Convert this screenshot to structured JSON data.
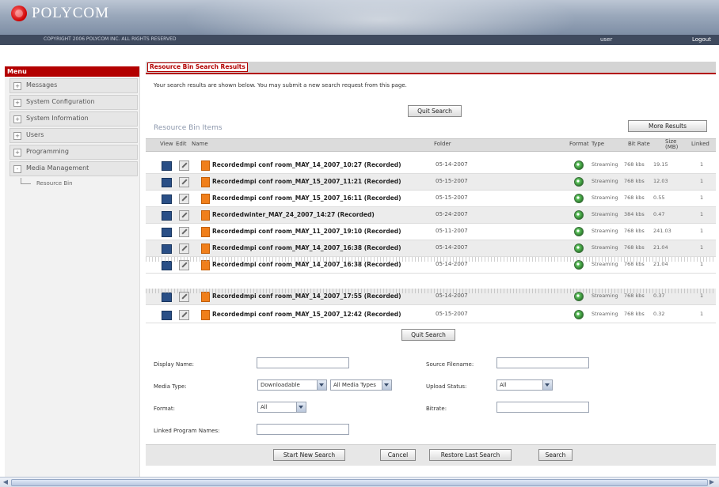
{
  "header": {
    "logo": "POLYCOM",
    "copyright": "COPYRIGHT 2006 POLYCOM INC. ALL RIGHTS RESERVED",
    "user": "user",
    "logout": "Logout"
  },
  "menu": {
    "title": "Menu",
    "items": [
      {
        "label": "Messages",
        "state": "+"
      },
      {
        "label": "System Configuration",
        "state": "+"
      },
      {
        "label": "System Information",
        "state": "+"
      },
      {
        "label": "Users",
        "state": "+"
      },
      {
        "label": "Programming",
        "state": "+"
      },
      {
        "label": "Media Management",
        "state": "-"
      }
    ],
    "sub": "Resource Bin"
  },
  "page": {
    "title": "Resource Bin Search Results",
    "info": "Your search results are shown below. You may submit a new search request from this page.",
    "quit_top": "Quit Search",
    "quit_bottom": "Quit Search",
    "items_label": "Resource Bin Items",
    "more": "More Results"
  },
  "columns": {
    "view": "View",
    "edit": "Edit",
    "name": "Name",
    "folder": "Folder",
    "format": "Format",
    "type": "Type",
    "bitrate": "Bit Rate",
    "size": "Size (MB)",
    "linked": "Linked"
  },
  "rows": [
    {
      "name": "Recordedmpi conf room_MAY_14_2007_10:27 (Recorded)",
      "folder": "05-14-2007",
      "type": "Streaming",
      "bitrate": "768 kbs",
      "size": "19.15",
      "linked": "1"
    },
    {
      "name": "Recordedmpi conf room_MAY_15_2007_11:21 (Recorded)",
      "folder": "05-15-2007",
      "type": "Streaming",
      "bitrate": "768 kbs",
      "size": "12.03",
      "linked": "1"
    },
    {
      "name": "Recordedmpi conf room_MAY_15_2007_16:11 (Recorded)",
      "folder": "05-15-2007",
      "type": "Streaming",
      "bitrate": "768 kbs",
      "size": "0.55",
      "linked": "1"
    },
    {
      "name": "Recordedwinter_MAY_24_2007_14:27 (Recorded)",
      "folder": "05-24-2007",
      "type": "Streaming",
      "bitrate": "384 kbs",
      "size": "0.47",
      "linked": "1"
    },
    {
      "name": "Recordedmpi conf room_MAY_11_2007_19:10 (Recorded)",
      "folder": "05-11-2007",
      "type": "Streaming",
      "bitrate": "768 kbs",
      "size": "241.03",
      "linked": "1"
    },
    {
      "name": "Recordedmpi conf room_MAY_14_2007_16:38 (Recorded)",
      "folder": "05-14-2007",
      "type": "Streaming",
      "bitrate": "768 kbs",
      "size": "21.04",
      "linked": "1"
    },
    {
      "name": "Recordedmpi conf room_MAY_14_2007_16:38 (Recorded)",
      "folder": "05-14-2007",
      "type": "Streaming",
      "bitrate": "768 kbs",
      "size": "21.04",
      "linked": "1"
    },
    {
      "name": "Recordedmpi conf room_MAY_14_2007_17:55 (Recorded)",
      "folder": "05-14-2007",
      "type": "Streaming",
      "bitrate": "768 kbs",
      "size": "0.37",
      "linked": "1"
    },
    {
      "name": "Recordedmpi conf room_MAY_15_2007_12:42 (Recorded)",
      "folder": "05-15-2007",
      "type": "Streaming",
      "bitrate": "768 kbs",
      "size": "0.32",
      "linked": "1"
    }
  ],
  "form": {
    "display_name": "Display Name:",
    "source_filename": "Source Filename:",
    "media_type": "Media Type:",
    "media_type_value": "Downloadable",
    "media_types_value": "All Media Types",
    "upload_status": "Upload Status:",
    "upload_status_value": "All",
    "format": "Format:",
    "format_value": "All",
    "bitrate": "Bitrate:",
    "linked_program": "Linked Program Names:"
  },
  "footer": {
    "start": "Start New Search",
    "cancel": "Cancel",
    "restore": "Restore Last Search",
    "search": "Search"
  }
}
